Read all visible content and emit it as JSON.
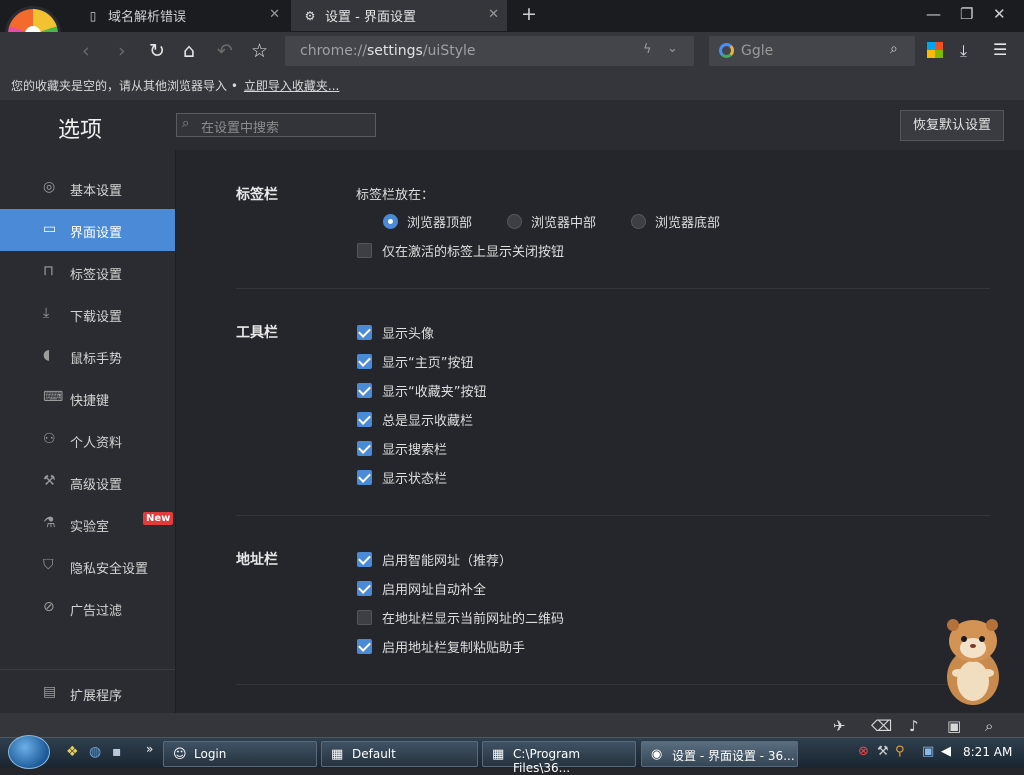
{
  "window": {
    "tabs": [
      {
        "icon": "page-icon",
        "title": "域名解析错误",
        "active": false
      },
      {
        "icon": "gear-icon",
        "title": "设置 - 界面设置",
        "active": true
      }
    ]
  },
  "toolbar": {
    "address_scheme": "chrome://",
    "address_path": "settings",
    "address_rest": "/uiStyle",
    "search_placeholder": "Ggle"
  },
  "bookmarks_bar": {
    "message": "您的收藏夹是空的，请从其他浏览器导入 •",
    "import_link": "立即导入收藏夹..."
  },
  "header": {
    "title": "选项",
    "search_placeholder": "在设置中搜索",
    "restore_button": "恢复默认设置"
  },
  "sidebar": {
    "items": [
      {
        "label": "基本设置",
        "icon": "circle-dot-icon"
      },
      {
        "label": "界面设置",
        "icon": "window-icon",
        "active": true
      },
      {
        "label": "标签设置",
        "icon": "tab-icon"
      },
      {
        "label": "下载设置",
        "icon": "download-icon"
      },
      {
        "label": "鼠标手势",
        "icon": "mouse-icon"
      },
      {
        "label": "快捷键",
        "icon": "keyboard-icon"
      },
      {
        "label": "个人资料",
        "icon": "person-icon"
      },
      {
        "label": "高级设置",
        "icon": "wrench-icon"
      },
      {
        "label": "实验室",
        "icon": "flask-icon",
        "badge": "New"
      },
      {
        "label": "隐私安全设置",
        "icon": "shield-icon"
      },
      {
        "label": "广告过滤",
        "icon": "block-icon"
      }
    ],
    "footer": {
      "label": "扩展程序",
      "icon": "extension-icon"
    }
  },
  "sections": {
    "tabbar": {
      "title": "标签栏",
      "position_label": "标签栏放在：",
      "positions": [
        {
          "label": "浏览器顶部",
          "selected": true
        },
        {
          "label": "浏览器中部",
          "selected": false
        },
        {
          "label": "浏览器底部",
          "selected": false
        }
      ],
      "options": [
        {
          "label": "仅在激活的标签上显示关闭按钮",
          "checked": false
        }
      ]
    },
    "toolbar": {
      "title": "工具栏",
      "options": [
        {
          "label": "显示头像",
          "checked": true
        },
        {
          "label": "显示“主页”按钮",
          "checked": true
        },
        {
          "label": "显示“收藏夹”按钮",
          "checked": true
        },
        {
          "label": "总是显示收藏栏",
          "checked": true
        },
        {
          "label": "显示搜索栏",
          "checked": true
        },
        {
          "label": "显示状态栏",
          "checked": true
        }
      ]
    },
    "addressbar": {
      "title": "地址栏",
      "options": [
        {
          "label": "启用智能网址（推荐）",
          "checked": true
        },
        {
          "label": "启用网址自动补全",
          "checked": true
        },
        {
          "label": "在地址栏显示当前网址的二维码",
          "checked": false
        },
        {
          "label": "启用地址栏复制粘贴助手",
          "checked": true
        }
      ]
    }
  },
  "taskbar": {
    "items": [
      {
        "label": "Login"
      },
      {
        "label": "Default"
      },
      {
        "label": "C:\\Program Files\\36..."
      },
      {
        "label": "设置 - 界面设置 - 36...",
        "active": true
      }
    ],
    "clock": "8:21 AM"
  },
  "colors": {
    "accent": "#4a8ad6",
    "background": "#25262b",
    "sidebar": "#2b2c31",
    "badge": "#e23b3b"
  }
}
